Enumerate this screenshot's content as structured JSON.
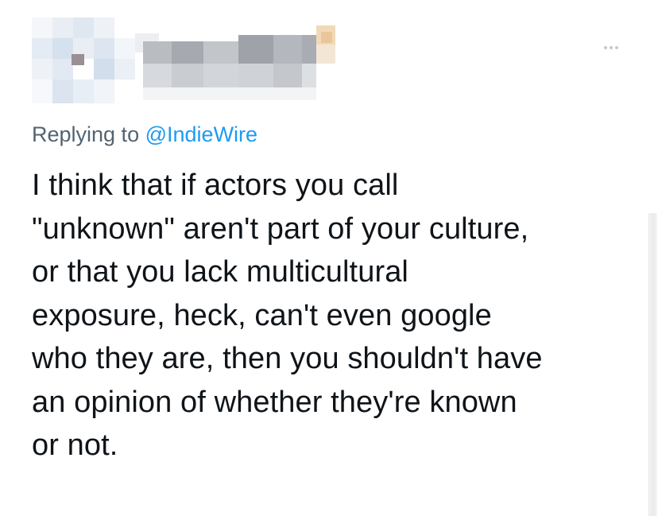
{
  "header": {
    "avatar": "pixelated-avatar",
    "name": "pixelated-name",
    "more_icon": "more-horizontal-icon"
  },
  "reply": {
    "prefix": "Replying to",
    "mention": "@IndieWire"
  },
  "tweet": {
    "lines": [
      "I think that if actors you call",
      "\"unknown\" aren't part of your culture,",
      "or that you lack multicultural",
      "exposure, heck, can't even google",
      "who they are, then you shouldn't have",
      "an opinion of whether they're known",
      "or not."
    ]
  },
  "colors": {
    "text": "#0f1419",
    "secondary": "#536471",
    "accent": "#1d9bf0"
  }
}
